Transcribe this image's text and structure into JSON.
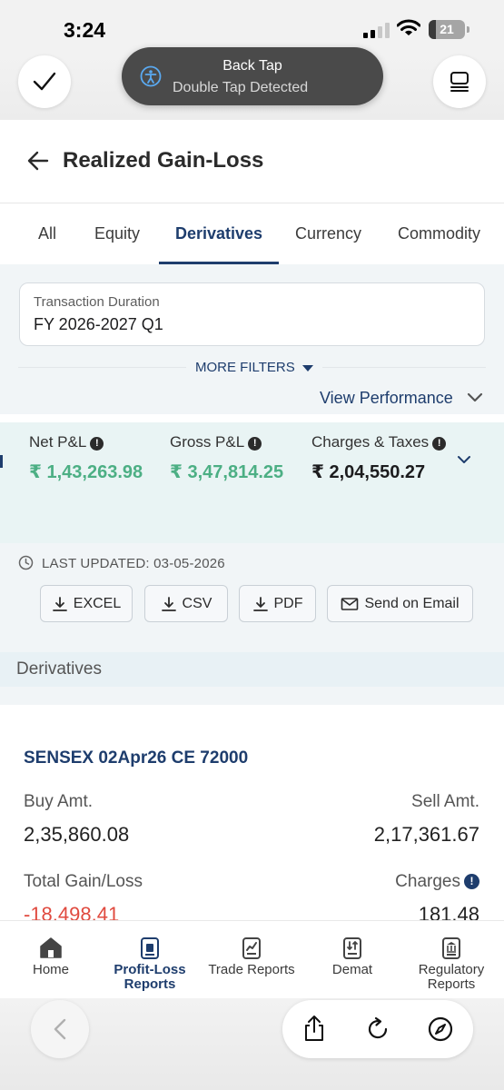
{
  "status_bar": {
    "time": "3:24",
    "battery": "21"
  },
  "browser": {
    "toast_title": "Back Tap",
    "toast_subtitle": "Double Tap Detected"
  },
  "header": {
    "title": "Realized Gain-Loss"
  },
  "tabs": [
    {
      "label": "All"
    },
    {
      "label": "Equity"
    },
    {
      "label": "Derivatives",
      "active": true
    },
    {
      "label": "Currency"
    },
    {
      "label": "Commodity"
    }
  ],
  "filters": {
    "duration_label": "Transaction Duration",
    "duration_value": "FY 2026-2027 Q1",
    "more_filters": "MORE FILTERS",
    "view_performance": "View Performance"
  },
  "summary": {
    "net_label": "Net P&L",
    "net_value": "₹ 1,43,263.98",
    "gross_label": "Gross P&L",
    "gross_value": "₹ 3,47,814.25",
    "charges_label": "Charges & Taxes",
    "charges_value": "₹ 2,04,550.27"
  },
  "last_updated": "LAST UPDATED: 03-05-2026",
  "exports": {
    "excel": "EXCEL",
    "csv": "CSV",
    "pdf": "PDF",
    "email": "Send on Email"
  },
  "section": {
    "title": "Derivatives"
  },
  "trade": {
    "instrument": "SENSEX 02Apr26 CE 72000",
    "buy_label": "Buy Amt.",
    "buy_value": "2,35,860.08",
    "sell_label": "Sell Amt.",
    "sell_value": "2,17,361.67",
    "gain_label": "Total Gain/Loss",
    "gain_value": "-18,498.41",
    "charges_label": "Charges",
    "charges_value": "181.48"
  },
  "bottom_nav": {
    "home": "Home",
    "pl_line1": "Profit-Loss",
    "pl_line2": "Reports",
    "trade": "Trade Reports",
    "demat": "Demat",
    "reg_line1": "Regulatory",
    "reg_line2": "Reports"
  },
  "colors": {
    "brand_navy": "#1e3d6d",
    "profit_green": "#4caf84",
    "loss_red": "#e04a3f"
  }
}
